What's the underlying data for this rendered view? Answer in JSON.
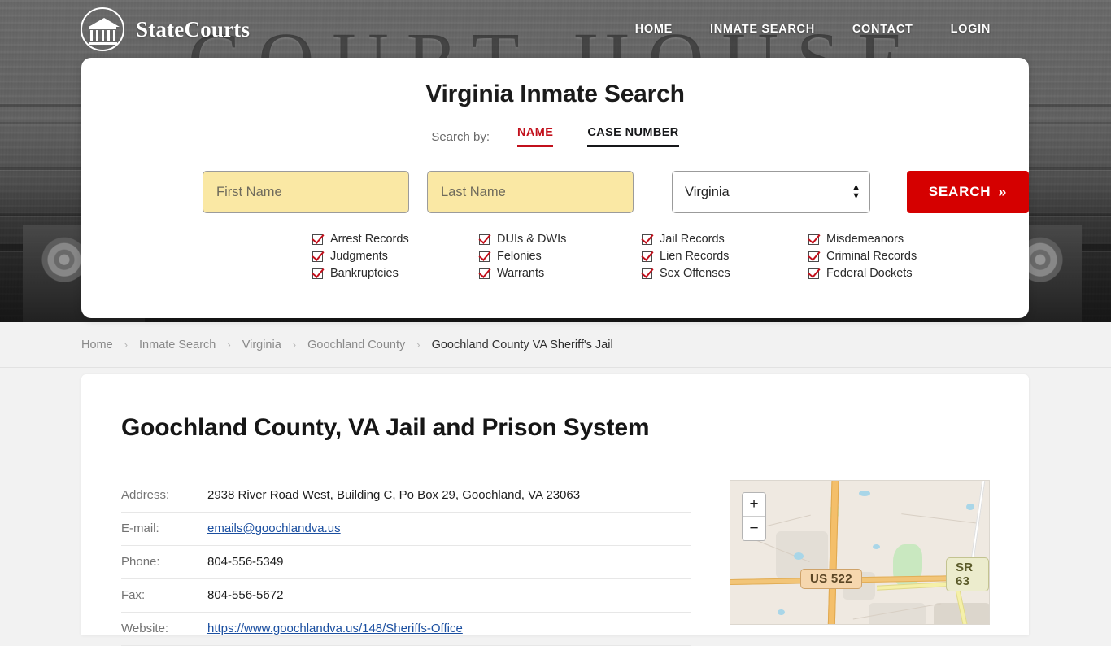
{
  "brand": {
    "name": "StateCourts",
    "logo_icon": "courthouse-circle-icon"
  },
  "nav": [
    {
      "label": "HOME"
    },
    {
      "label": "INMATE SEARCH"
    },
    {
      "label": "CONTACT"
    },
    {
      "label": "LOGIN"
    }
  ],
  "hero": {
    "background_word": "COURT HOUSE"
  },
  "search": {
    "title": "Virginia Inmate Search",
    "search_by_label": "Search by:",
    "tabs": [
      {
        "label": "NAME",
        "active": true,
        "color": "#c2101c"
      },
      {
        "label": "CASE NUMBER",
        "active": false,
        "color": "#17181a"
      }
    ],
    "first_name_placeholder": "First Name",
    "first_name_value": "",
    "last_name_placeholder": "Last Name",
    "last_name_value": "",
    "state_selected": "Virginia",
    "button_label": "SEARCH",
    "button_chevron": "»",
    "button_color": "#d50000",
    "input_color": "#fae8a4",
    "record_types": [
      "Arrest Records",
      "DUIs & DWIs",
      "Jail Records",
      "Misdemeanors",
      "Judgments",
      "Felonies",
      "Lien Records",
      "Criminal Records",
      "Bankruptcies",
      "Warrants",
      "Sex Offenses",
      "Federal Dockets"
    ]
  },
  "breadcrumb": {
    "separator": "›",
    "items": [
      {
        "label": "Home",
        "current": false
      },
      {
        "label": "Inmate Search",
        "current": false
      },
      {
        "label": "Virginia",
        "current": false
      },
      {
        "label": "Goochland County",
        "current": false
      },
      {
        "label": "Goochland County VA Sheriff's Jail",
        "current": true
      }
    ]
  },
  "page": {
    "title": "Goochland County, VA Jail and Prison System",
    "details": [
      {
        "key": "Address:",
        "value": "2938 River Road West, Building C, Po Box 29, Goochland, VA 23063",
        "link": false
      },
      {
        "key": "E-mail:",
        "value": "emails@goochlandva.us",
        "link": true
      },
      {
        "key": "Phone:",
        "value": "804-556-5349",
        "link": false
      },
      {
        "key": "Fax:",
        "value": "804-556-5672",
        "link": false
      },
      {
        "key": "Website:",
        "value": "https://www.goochlandva.us/148/Sheriffs-Office",
        "link": true
      }
    ]
  },
  "map": {
    "zoom_in_label": "+",
    "zoom_out_label": "−",
    "labels": [
      {
        "text": "US 522"
      },
      {
        "text": "SR 63"
      }
    ]
  }
}
